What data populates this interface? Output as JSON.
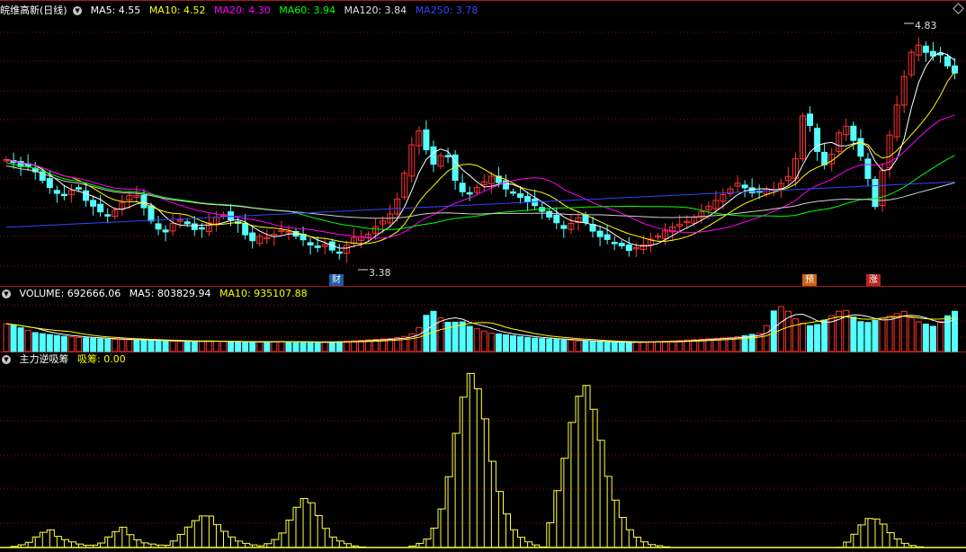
{
  "main": {
    "stock_title": "皖维高新(日线)",
    "ma": [
      {
        "label": "MA5: 4.55",
        "color": "#ffffff"
      },
      {
        "label": "MA10: 4.52",
        "color": "#ffff00"
      },
      {
        "label": "MA20: 4.30",
        "color": "#ff00ff"
      },
      {
        "label": "MA60: 3.94",
        "color": "#00ff00"
      },
      {
        "label": "MA120: 3.84",
        "color": "#e0e0e0"
      },
      {
        "label": "MA250: 3.78",
        "color": "#3344ff"
      }
    ],
    "high_label": "4.83",
    "low_label": "3.38",
    "markers": [
      {
        "text": "财",
        "bg": "#1e5aa8"
      },
      {
        "text": "预",
        "bg": "#c86414"
      },
      {
        "text": "涨",
        "bg": "#b4281e"
      }
    ]
  },
  "volume": {
    "title": "VOLUME: 692666.06",
    "ma5": "MA5: 803829.94",
    "ma10": "MA10: 935107.88"
  },
  "indicator": {
    "title": "主力逆吸筹",
    "value": "吸筹: 0.00"
  },
  "colors": {
    "up": "#ff3232",
    "down": "#54ffff",
    "ma5": "#ffffff",
    "ma10": "#ffff00",
    "ma20": "#ff00ff",
    "ma60": "#00ff00",
    "ma120": "#d0d0d0",
    "ma250": "#3344ff",
    "grid": "#8a1010",
    "indicator": "#ffff44"
  },
  "chart_data": {
    "type": "candlestick",
    "close_series": [
      4.0,
      3.98,
      3.95,
      3.96,
      3.9,
      3.84,
      3.8,
      3.76,
      3.8,
      3.82,
      3.74,
      3.7,
      3.66,
      3.64,
      3.7,
      3.75,
      3.8,
      3.72,
      3.62,
      3.56,
      3.54,
      3.6,
      3.62,
      3.58,
      3.54,
      3.58,
      3.62,
      3.66,
      3.62,
      3.6,
      3.52,
      3.48,
      3.52,
      3.5,
      3.54,
      3.56,
      3.52,
      3.5,
      3.46,
      3.44,
      3.46,
      3.42,
      3.4,
      3.48,
      3.52,
      3.5,
      3.56,
      3.6,
      3.64,
      3.74,
      3.92,
      4.12,
      4.2,
      4.0,
      3.95,
      4.1,
      3.9,
      3.8,
      3.78,
      3.82,
      3.86,
      3.9,
      3.84,
      3.8,
      3.78,
      3.74,
      3.72,
      3.68,
      3.64,
      3.6,
      3.56,
      3.6,
      3.64,
      3.58,
      3.52,
      3.5,
      3.48,
      3.46,
      3.42,
      3.44,
      3.46,
      3.5,
      3.52,
      3.56,
      3.58,
      3.6,
      3.62,
      3.66,
      3.7,
      3.74,
      3.78,
      3.82,
      3.86,
      3.8,
      3.78,
      3.82,
      3.8,
      3.84,
      3.88,
      4.0,
      4.3,
      4.2,
      4.0,
      3.95,
      4.1,
      4.25,
      4.15,
      4.05,
      3.9,
      3.7,
      3.95,
      4.2,
      4.4,
      4.6,
      4.75,
      4.7,
      4.65,
      4.68,
      4.6,
      4.55
    ],
    "volume_series": [
      900000,
      820000,
      700000,
      600000,
      560000,
      520000,
      480000,
      460000,
      440000,
      420000,
      400000,
      390000,
      380000,
      370000,
      360000,
      350000,
      340000,
      330000,
      320000,
      330000,
      340000,
      330000,
      320000,
      310000,
      300000,
      310000,
      320000,
      330000,
      320000,
      310000,
      300000,
      290000,
      300000,
      320000,
      340000,
      360000,
      380000,
      400000,
      420000,
      460000,
      520000,
      800000,
      1400000,
      1100000,
      900000,
      1000000,
      800000,
      700000,
      600000,
      560000,
      520000,
      480000,
      440000,
      420000,
      400000,
      380000,
      360000,
      340000,
      320000,
      310000,
      300000,
      290000,
      300000,
      310000,
      320000,
      330000,
      340000,
      360000,
      380000,
      400000,
      420000,
      440000,
      460000,
      500000,
      560000,
      600000,
      1300000,
      1500000,
      1100000,
      900000,
      800000,
      1000000,
      1200000,
      1400000,
      1100000,
      900000,
      1000000,
      1100000,
      1200000,
      1300000,
      1000000,
      900000,
      800000,
      1100000,
      1300000
    ],
    "indicator_series": [
      0,
      1,
      3,
      8,
      12,
      6,
      4,
      2,
      1,
      3,
      9,
      13,
      6,
      3,
      2,
      1,
      5,
      12,
      18,
      22,
      14,
      8,
      4,
      2,
      1,
      3,
      8,
      20,
      32,
      28,
      14,
      6,
      3,
      1,
      0,
      0,
      0,
      0,
      0,
      2,
      6,
      18,
      48,
      90,
      112,
      96,
      56,
      28,
      12,
      5,
      2,
      0,
      30,
      60,
      94,
      104,
      80,
      46,
      24,
      12,
      5,
      2,
      1,
      0,
      0,
      0,
      0,
      0,
      0,
      0,
      0,
      0,
      0,
      0,
      0,
      0,
      0,
      0,
      0,
      0,
      5,
      14,
      20,
      16,
      8,
      3,
      1,
      0,
      0,
      0,
      0
    ],
    "y_range": [
      3.3,
      4.9
    ]
  }
}
